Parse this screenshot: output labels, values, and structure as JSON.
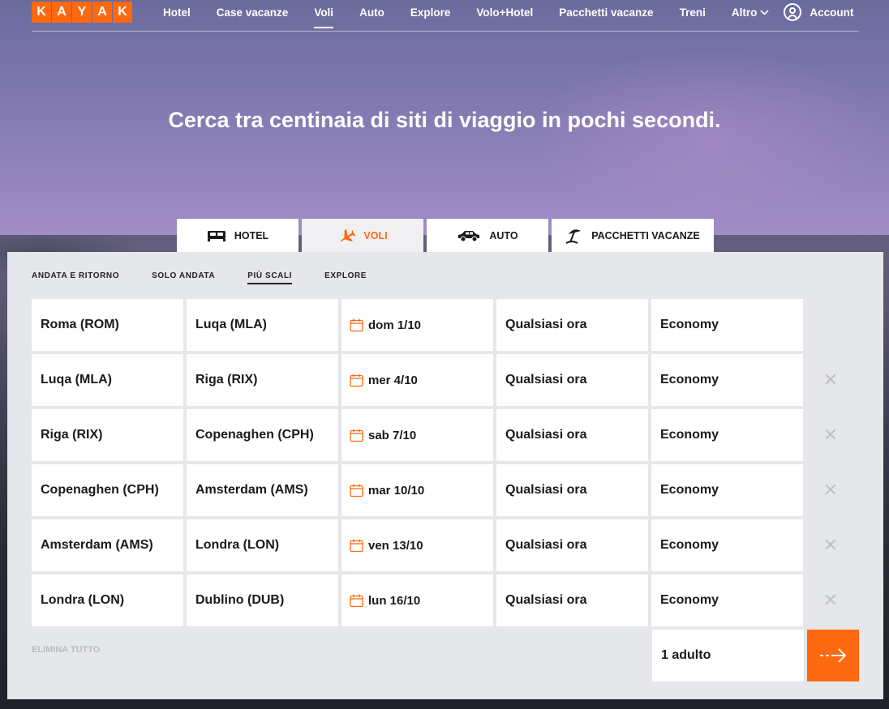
{
  "logo_letters": [
    "K",
    "A",
    "Y",
    "A",
    "K"
  ],
  "nav": {
    "items": [
      "Hotel",
      "Case vacanze",
      "Voli",
      "Auto",
      "Explore",
      "Volo+Hotel",
      "Pacchetti vacanze",
      "Treni"
    ],
    "more_label": "Altro",
    "account_label": "Account",
    "active_index": 2
  },
  "headline": "Cerca tra centinaia di siti di viaggio in pochi secondi.",
  "product_tabs": [
    {
      "label": "HOTEL",
      "icon": "bed-icon"
    },
    {
      "label": "VOLI",
      "icon": "plane-icon"
    },
    {
      "label": "AUTO",
      "icon": "car-icon"
    },
    {
      "label": "PACCHETTI VACANZE",
      "icon": "beach-umbrella-icon"
    }
  ],
  "trip_modes": [
    "ANDATA E RITORNO",
    "SOLO ANDATA",
    "PIÙ SCALI",
    "EXPLORE"
  ],
  "legs": [
    {
      "from": "Roma (ROM)",
      "to": "Luqa (MLA)",
      "date": "dom 1/10",
      "time": "Qualsiasi ora",
      "cabin": "Economy"
    },
    {
      "from": "Luqa (MLA)",
      "to": "Riga (RIX)",
      "date": "mer 4/10",
      "time": "Qualsiasi ora",
      "cabin": "Economy"
    },
    {
      "from": "Riga (RIX)",
      "to": "Copenaghen (CPH)",
      "date": "sab 7/10",
      "time": "Qualsiasi ora",
      "cabin": "Economy"
    },
    {
      "from": "Copenaghen (CPH)",
      "to": "Amsterdam (AMS)",
      "date": "mar 10/10",
      "time": "Qualsiasi ora",
      "cabin": "Economy"
    },
    {
      "from": "Amsterdam (AMS)",
      "to": "Londra (LON)",
      "date": "ven 13/10",
      "time": "Qualsiasi ora",
      "cabin": "Economy"
    },
    {
      "from": "Londra (LON)",
      "to": "Dublino (DUB)",
      "date": "lun 16/10",
      "time": "Qualsiasi ora",
      "cabin": "Economy"
    }
  ],
  "remove_symbol": "✕",
  "delete_all_label": "ELIMINA TUTTO",
  "travelers_label": "1 adulto",
  "colors": {
    "brand": "#ff690f",
    "text": "#1a1a1a",
    "panel": "#e6e7ea"
  }
}
